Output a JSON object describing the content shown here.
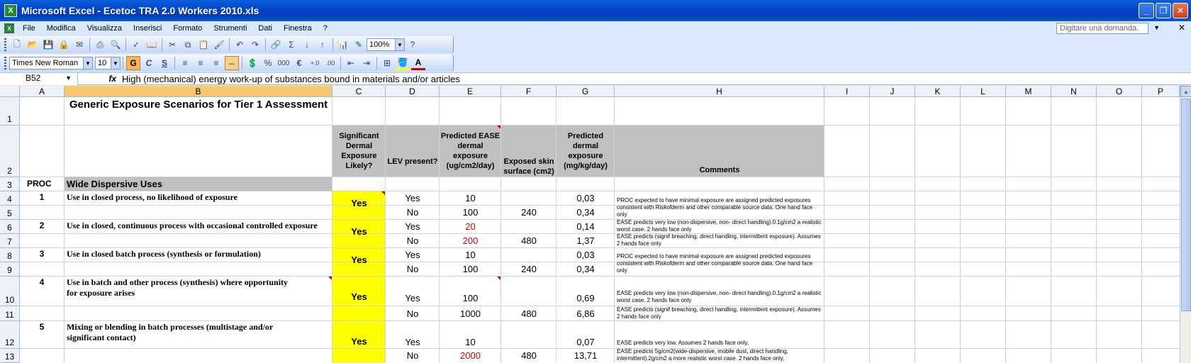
{
  "window": {
    "title": "Microsoft Excel - Ecetoc TRA 2.0 Workers 2010.xls",
    "app_icon": "X",
    "buttons": [
      "minimize-icon",
      "restore-icon",
      "close-icon"
    ]
  },
  "menu": {
    "items": [
      "File",
      "Modifica",
      "Visualizza",
      "Inserisci",
      "Formato",
      "Strumenti",
      "Dati",
      "Finestra",
      "?"
    ],
    "help_placeholder": "Digitare una domanda."
  },
  "toolbar_standard": {
    "zoom": "100%"
  },
  "toolbar_format": {
    "font": "Times New Roman",
    "size": "10",
    "bold": "G",
    "italic": "C",
    "underline": "S",
    "percent": "%",
    "thousands": "000",
    "currency": "€"
  },
  "formula_bar": {
    "cell_ref": "B52",
    "fx": "fx",
    "content": "High (mechanical) energy work-up of substances bound in materials and/or articles"
  },
  "columns": [
    "A",
    "B",
    "C",
    "D",
    "E",
    "F",
    "G",
    "H",
    "I",
    "J",
    "K",
    "L",
    "M",
    "N",
    "O",
    "P"
  ],
  "selected_column": "B",
  "rows": [
    "1",
    "2",
    "3",
    "4",
    "5",
    "6",
    "7",
    "8",
    "9",
    "10",
    "11",
    "12",
    "13"
  ],
  "sheet": {
    "title": "Generic Exposure Scenarios for Tier 1 Assessment",
    "headers": {
      "c": "Significant Dermal Exposure Likely?",
      "d": "LEV present?",
      "e": "Predicted EASE dermal exposure (ug/cm2/day)",
      "f": "Exposed skin surface (cm2)",
      "g": "Predicted dermal exposure (mg/kg/day)",
      "h": "Comments"
    },
    "section_proc": "PROC",
    "section_label": "Wide Dispersive Uses",
    "entries": [
      {
        "proc": "1",
        "name": "Use in closed process, no likelihood of exposure",
        "likely": "Yes",
        "lev": [
          "Yes",
          "No"
        ],
        "ease": [
          "10",
          "100"
        ],
        "skin": "240",
        "dermal": [
          "0,03",
          "0,34"
        ],
        "comment": "PROC expected to have minimal exposure are assigned predicted exposures consistent with Riskofderm and other comparable source data. One hand face only"
      },
      {
        "proc": "2",
        "name": "Use in closed, continuous  process with occasional controlled exposure",
        "likely": "Yes",
        "lev": [
          "Yes",
          "No"
        ],
        "ease": [
          "20",
          "200"
        ],
        "skin": "480",
        "dermal": [
          "0,14",
          "1,37"
        ],
        "comment_top": "EASE predicts very low (non-dispersive, non- direct handling).0.1g/cm2 a realistic worst case. 2 hands face only",
        "comment_bottom": "EASE predicts (signif breaching, direct handling, intermittent exposure). Assumes 2 hands face only"
      },
      {
        "proc": "3",
        "name": "Use in closed batch process (synthesis or formulation)",
        "likely": "Yes",
        "lev": [
          "Yes",
          "No"
        ],
        "ease": [
          "10",
          "100"
        ],
        "skin": "240",
        "dermal": [
          "0,03",
          "0,34"
        ],
        "comment": "PROC expected to have minimal exposure are assigned predicted exposures consistent with Riskofderm and other comparable source data. One hand face only"
      },
      {
        "proc": "4",
        "name": "Use in batch and other process (synthesis) where opportunity for exposure arises",
        "likely": "Yes",
        "lev": [
          "Yes",
          "No"
        ],
        "ease": [
          "100",
          "1000"
        ],
        "skin": "480",
        "dermal": [
          "0,69",
          "6,86"
        ],
        "comment_top": "EASE predicts very low (non-dispersive, non- direct handling).0.1g/cm2 a realistic worst case. 2 hands face only",
        "comment_bottom": "EASE predicts (signif breaching, direct handling, intermittent exposure). Assumes 2 hands face only"
      },
      {
        "proc": "5",
        "name": "Mixing or blending in batch processes (multistage and/or significant contact)",
        "likely": "Yes",
        "lev": [
          "Yes",
          "No"
        ],
        "ease": [
          "10",
          "2000"
        ],
        "skin": "480",
        "dermal": [
          "0,07",
          "13,71"
        ],
        "comment_top": " EASE predicts  very low. Assumes 2 hands face only,",
        "comment_bottom": "EASE predicts 5g/cm2(wide-dispersive, mobile dust, direct handling, intermittent).2g/cm2 a more realistic worst case. 2 hands face only,"
      }
    ]
  }
}
